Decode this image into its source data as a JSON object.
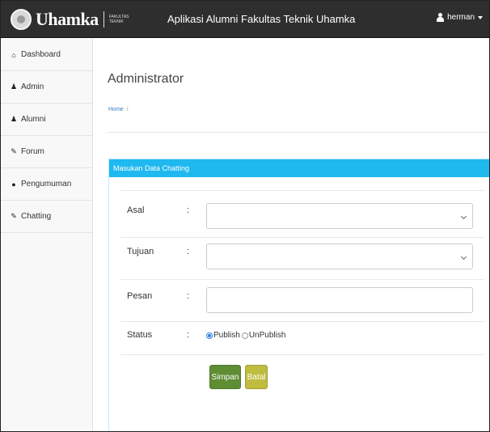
{
  "header": {
    "brand_name": "Uhamka",
    "brand_sub": "FAKULTAS TEKNIK",
    "app_title": "Aplikasi Alumni Fakultas Teknik Uhamka",
    "user_name": "herman"
  },
  "sidebar": {
    "items": [
      {
        "label": "Dashboard",
        "icon": "home-icon",
        "glyph": "⌂"
      },
      {
        "label": "Admin",
        "icon": "user-icon",
        "glyph": "♟"
      },
      {
        "label": "Alumni",
        "icon": "user-icon",
        "glyph": "♟"
      },
      {
        "label": "Forum",
        "icon": "chat-icon",
        "glyph": "✎"
      },
      {
        "label": "Pengumuman",
        "icon": "info-icon",
        "glyph": "●"
      },
      {
        "label": "Chatting",
        "icon": "chat-icon",
        "glyph": "✎"
      }
    ]
  },
  "main": {
    "page_title": "Administrator",
    "breadcrumb": "Home",
    "breadcrumb_sep": "/",
    "panel_title": "Masukan Data Chatting",
    "form": {
      "asal_label": "Asal",
      "tujuan_label": "Tujuan",
      "pesan_label": "Pesan",
      "status_label": "Status",
      "colon": ":",
      "status_options": [
        "Publish",
        "UnPublish"
      ],
      "status_selected": "Publish"
    },
    "buttons": {
      "save_label": "Simpan",
      "cancel_label": "Batal"
    }
  },
  "colors": {
    "navbar": "#2e2e2e",
    "panel_header": "#1fb8ef",
    "save_button": "#5f8d34",
    "cancel_button": "#bfbc3f"
  }
}
